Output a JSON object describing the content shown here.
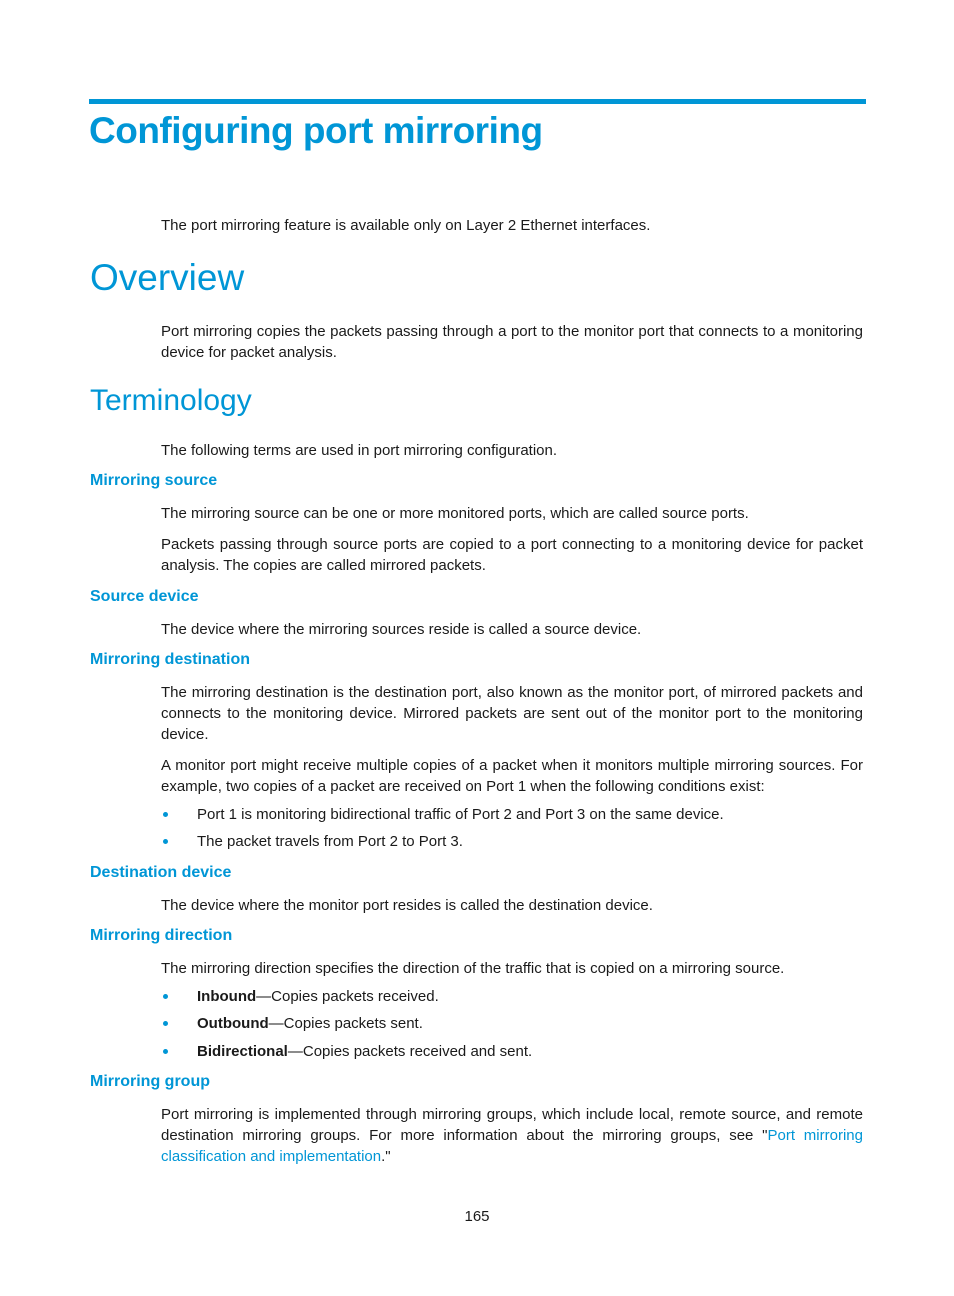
{
  "chapter_title": "Configuring port mirroring",
  "intro_note": "The port mirroring feature is available only on Layer 2 Ethernet interfaces.",
  "overview": {
    "heading": "Overview",
    "text": "Port mirroring copies the packets passing through a port to the monitor port that connects to a monitoring device for packet analysis."
  },
  "terminology": {
    "heading": "Terminology",
    "intro": "The following terms are used in port mirroring configuration.",
    "mirroring_source": {
      "heading": "Mirroring source",
      "p1": "The mirroring source can be one or more monitored ports, which are called source ports.",
      "p2": "Packets passing through source ports are copied to a port connecting to a monitoring device for packet analysis. The copies are called mirrored packets."
    },
    "source_device": {
      "heading": "Source device",
      "p1": "The device where the mirroring sources reside is called a source device."
    },
    "mirroring_destination": {
      "heading": "Mirroring destination",
      "p1": "The mirroring destination is the destination port, also known as the monitor port, of mirrored packets and connects to the monitoring device. Mirrored packets are sent out of the monitor port to the monitoring device.",
      "p2": "A monitor port might receive multiple copies of a packet when it monitors multiple mirroring sources. For example, two copies of a packet are received on Port 1 when the following conditions exist:",
      "bullets": [
        "Port 1 is monitoring bidirectional traffic of Port 2 and Port 3 on the same device.",
        "The packet travels from Port 2 to Port 3."
      ]
    },
    "destination_device": {
      "heading": "Destination device",
      "p1": "The device where the monitor port resides is called the destination device."
    },
    "mirroring_direction": {
      "heading": "Mirroring direction",
      "p1": "The mirroring direction specifies the direction of the traffic that is copied on a mirroring source.",
      "bullets": [
        {
          "term": "Inbound",
          "desc": "—Copies packets received."
        },
        {
          "term": "Outbound",
          "desc": "—Copies packets sent."
        },
        {
          "term": "Bidirectional",
          "desc": "—Copies packets received and sent."
        }
      ]
    },
    "mirroring_group": {
      "heading": "Mirroring group",
      "p1_before": "Port mirroring is implemented through mirroring groups, which include local, remote source, and remote destination mirroring groups. For more information about the mirroring groups, see \"",
      "p1_link": "Port mirroring classification and implementation",
      "p1_after": ".\""
    }
  },
  "page_number": "165",
  "colors": {
    "accent": "#0096d6",
    "text": "#1a1a1a"
  }
}
